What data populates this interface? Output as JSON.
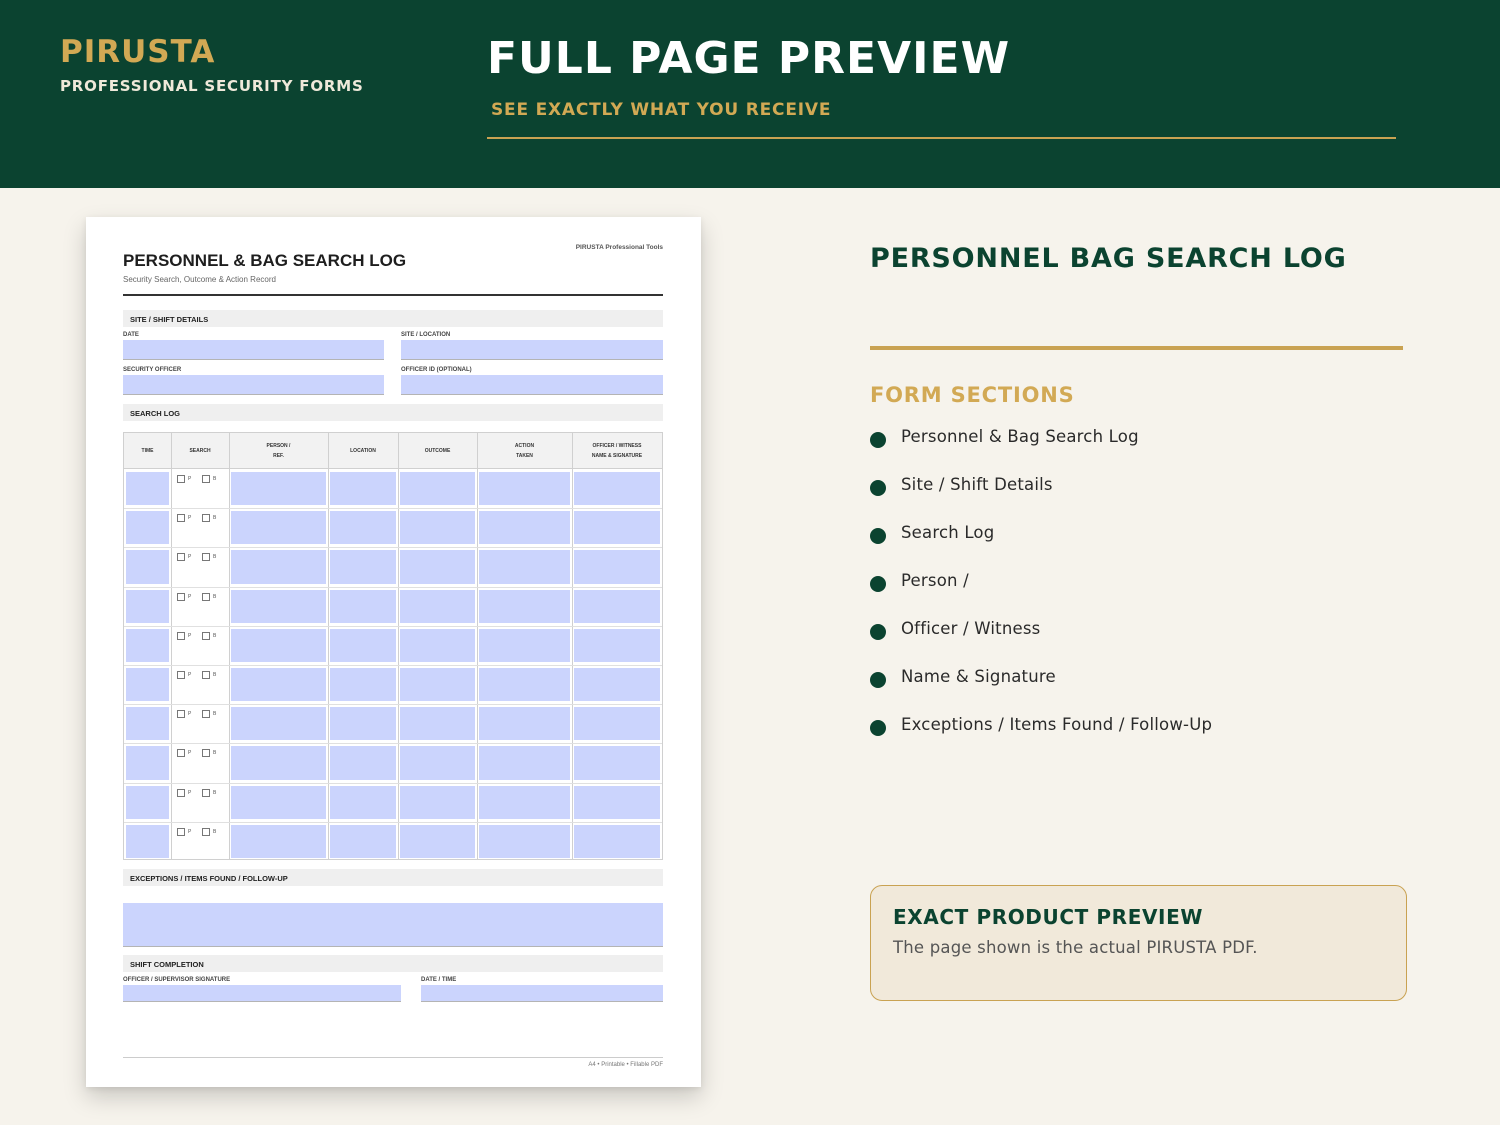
{
  "header": {
    "brand": "PIRUSTA",
    "brand_sub": "PROFESSIONAL SECURITY FORMS",
    "title": "FULL PAGE PREVIEW",
    "subtitle": "SEE EXACTLY WHAT YOU RECEIVE"
  },
  "colors": {
    "dark_green": "#0b4330",
    "gold": "#d2a954",
    "cream": "#f6f3ec",
    "field_fill": "#cbd4fd"
  },
  "form": {
    "brand_tag": "PIRUSTA Professional Tools",
    "title": "PERSONNEL & BAG SEARCH LOG",
    "subtitle": "Security Search, Outcome & Action Record",
    "section_site": "SITE / SHIFT DETAILS",
    "label_date": "DATE",
    "label_site": "SITE / LOCATION",
    "label_officer": "SECURITY OFFICER",
    "label_officer_id": "OFFICER ID (OPTIONAL)",
    "section_log": "SEARCH LOG",
    "columns": [
      "TIME",
      "SEARCH",
      "PERSON /\nREF.",
      "LOCATION",
      "OUTCOME",
      "ACTION\nTAKEN",
      "OFFICER / WITNESS\nNAME & SIGNATURE"
    ],
    "checkbox_p": "P",
    "checkbox_b": "B",
    "section_exceptions": "EXCEPTIONS / ITEMS FOUND / FOLLOW-UP",
    "section_completion": "SHIFT COMPLETION",
    "label_signature": "OFFICER / SUPERVISOR SIGNATURE",
    "label_datetime": "DATE / TIME",
    "footer": "A4 • Printable • Fillable PDF"
  },
  "panel": {
    "title": "PERSONNEL BAG SEARCH LOG",
    "sections_heading": "FORM SECTIONS",
    "sections": [
      "Personnel & Bag Search Log",
      "Site / Shift Details",
      "Search Log",
      "Person /",
      "Officer / Witness",
      "Name & Signature",
      "Exceptions / Items Found / Follow-Up"
    ],
    "notice_title": "EXACT PRODUCT PREVIEW",
    "notice_text": "The page shown is the actual PIRUSTA PDF."
  }
}
